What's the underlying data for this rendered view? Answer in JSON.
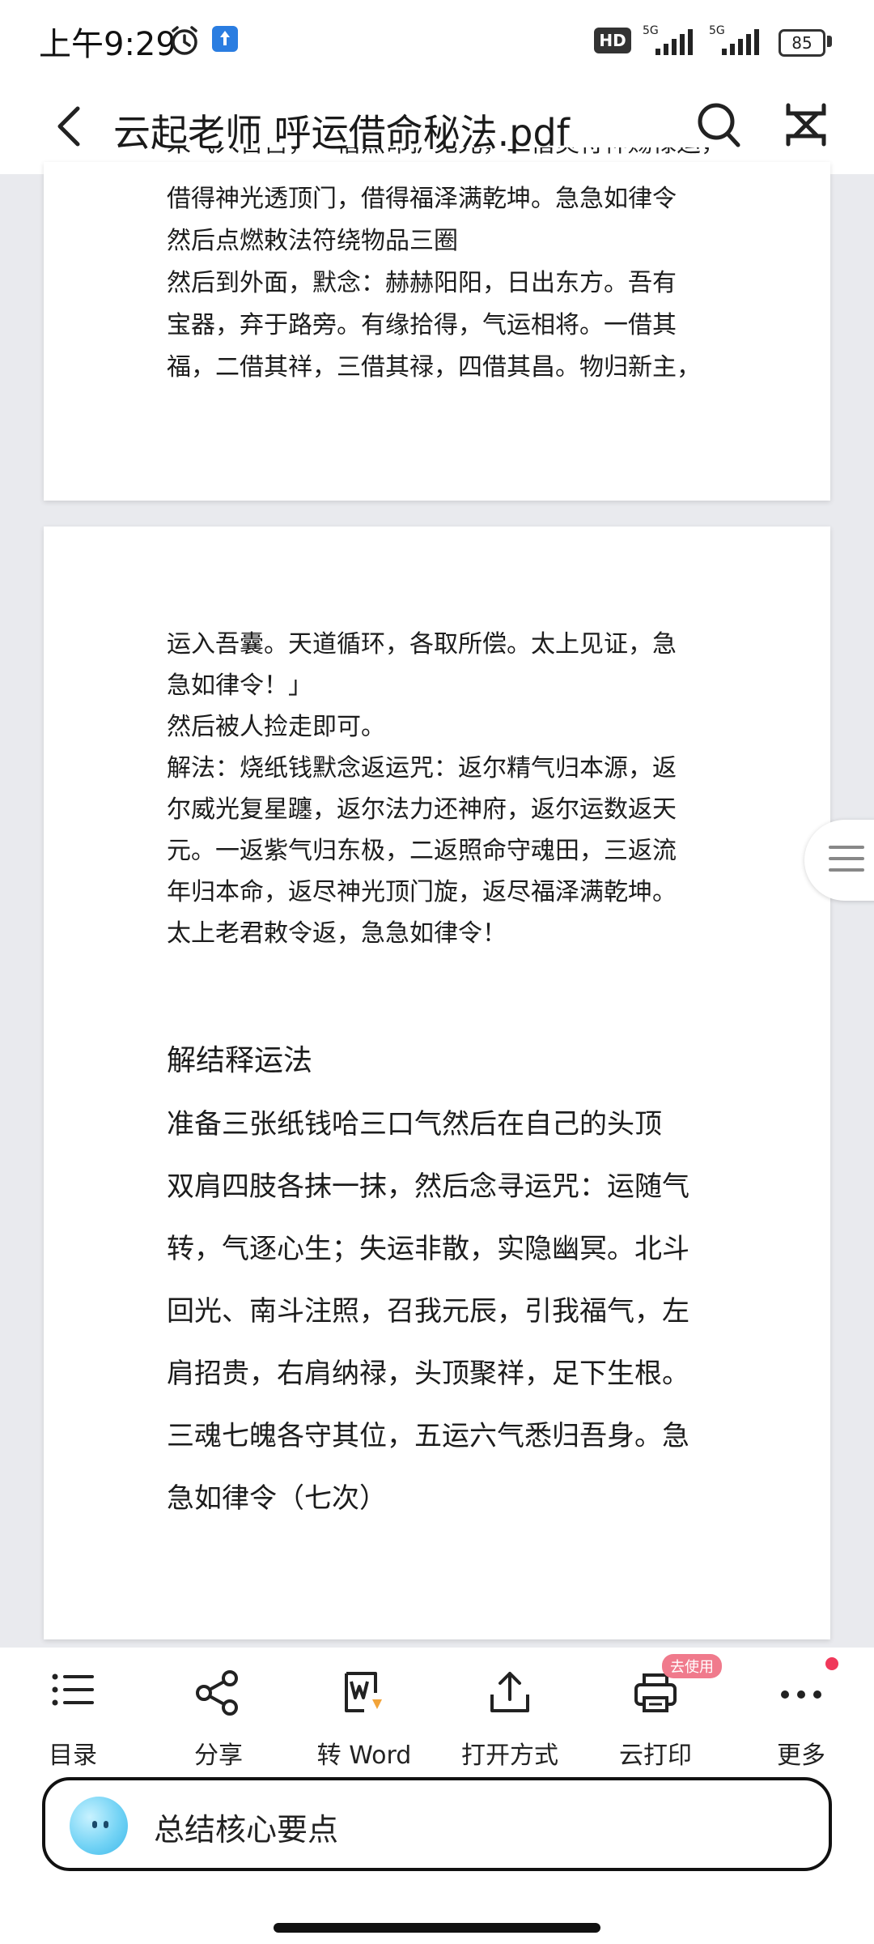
{
  "status_bar": {
    "time": "上午9:29",
    "network_badge": "HD",
    "signal_1": "5G",
    "signal_2": "5G",
    "battery": "85"
  },
  "header": {
    "title": "云起老师 呼运借命秘法.pdf"
  },
  "page1": {
    "cut_line": "来气入吾宫，一借照命护见光，二借灵符神赐禄运，",
    "lines": [
      "借得神光透顶门，借得福泽满乾坤。急急如律令",
      "然后点燃敕法符绕物品三圈",
      "然后到外面，默念：赫赫阳阳，日出东方。吾有",
      "宝器，弃于路旁。有缘拾得，气运相将。一借其",
      "福，二借其祥，三借其禄，四借其昌。物归新主，"
    ]
  },
  "page2": {
    "lines": [
      "运入吾囊。天道循环，各取所偿。太上见证，急",
      "急如律令！」",
      "然后被人捡走即可。",
      "解法：烧纸钱默念返运咒：返尔精气归本源，返",
      "尔威光复星躔，返尔法力还神府，返尔运数返天",
      "元。一返紫气归东极，二返照命守魂田，三返流",
      "年归本命，返尽神光顶门旋，返尽福泽满乾坤。",
      "太上老君敕令返，急急如律令！"
    ],
    "heading": "解结释运法",
    "body_lines": [
      "准备三张纸钱哈三口气然后在自己的头顶",
      "双肩四肢各抹一抹，然后念寻运咒：运随气",
      "转，气逐心生；失运非散，实隐幽冥。北斗",
      "回光、南斗注照，召我元辰，引我福气，左",
      "肩招贵，右肩纳禄，头顶聚祥，足下生根。",
      "三魂七魄各守其位，五运六气悉归吾身。急",
      "急如律令（七次）"
    ]
  },
  "toolbar": {
    "items": [
      {
        "label": "目录",
        "icon": "list-icon"
      },
      {
        "label": "分享",
        "icon": "share-icon"
      },
      {
        "label": "转 Word",
        "icon": "word-convert-icon"
      },
      {
        "label": "打开方式",
        "icon": "open-with-icon"
      },
      {
        "label": "云打印",
        "icon": "printer-icon",
        "badge": "去使用"
      },
      {
        "label": "更多",
        "icon": "more-icon"
      }
    ]
  },
  "ai_bar": {
    "text": "总结核心要点"
  },
  "colors": {
    "accent_blue": "#2a7de1",
    "badge_pink": "#f07a8c",
    "dot_red": "#f0385a",
    "page_bg": "#e9eaee"
  }
}
